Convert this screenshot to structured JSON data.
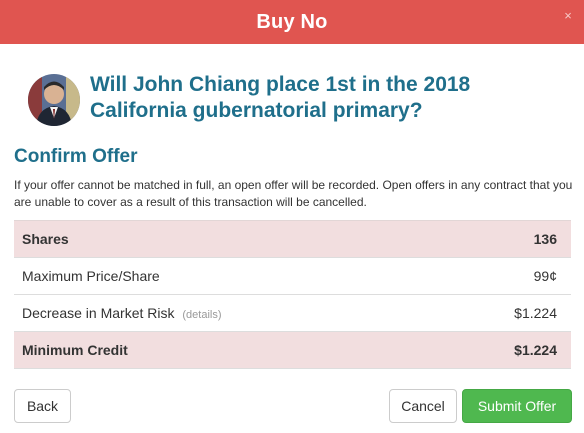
{
  "modal": {
    "title": "Buy No",
    "close_symbol": "×"
  },
  "contract": {
    "question": "Will John Chiang place 1st in the 2018 California gubernatorial primary?",
    "avatar_icon": "candidate-photo"
  },
  "confirm": {
    "heading": "Confirm Offer",
    "notice": "If your offer cannot be matched in full, an open offer will be recorded. Open offers in any contract that you are unable to cover as a result of this transaction will be cancelled."
  },
  "summary": {
    "shares_label": "Shares",
    "shares_value": "136",
    "max_price_label": "Maximum Price/Share",
    "max_price_value": "99¢",
    "risk_label": "Decrease in Market Risk",
    "risk_details": "(details)",
    "risk_value": "$1.224",
    "min_credit_label": "Minimum Credit",
    "min_credit_value": "$1.224"
  },
  "buttons": {
    "back": "Back",
    "cancel": "Cancel",
    "submit": "Submit Offer"
  },
  "colors": {
    "header": "#e05550",
    "title_blue": "#1f6f8b",
    "highlight_row": "#f2dedf",
    "submit_green": "#4fb84f"
  }
}
